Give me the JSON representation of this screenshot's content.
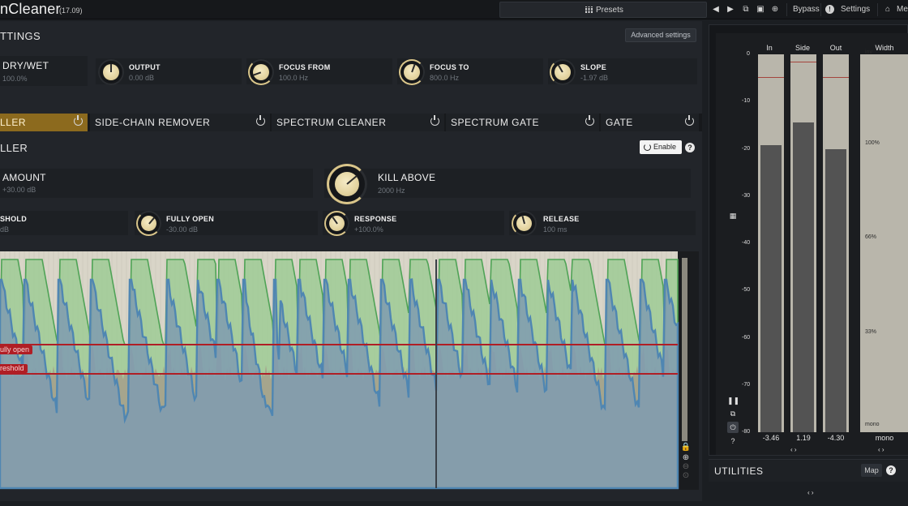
{
  "header": {
    "title": "nCleaner",
    "version": "(17.09)",
    "presets_label": "Presets",
    "bypass_label": "Bypass",
    "settings_label": "Settings",
    "menu_label": "Me"
  },
  "settings": {
    "title": "TTINGS",
    "advanced_label": "Advanced settings",
    "params": [
      {
        "name": "DRY/WET",
        "value": "100.0%"
      },
      {
        "name": "OUTPUT",
        "value": "0.00 dB"
      },
      {
        "name": "FOCUS FROM",
        "value": "100.0 Hz"
      },
      {
        "name": "FOCUS TO",
        "value": "800.0 Hz"
      },
      {
        "name": "SLOPE",
        "value": "-1.97 dB"
      }
    ]
  },
  "tabs": [
    {
      "label": "LLER",
      "active": true
    },
    {
      "label": "SIDE-CHAIN REMOVER",
      "active": false
    },
    {
      "label": "SPECTRUM CLEANER",
      "active": false
    },
    {
      "label": "SPECTRUM GATE",
      "active": false
    },
    {
      "label": "GATE",
      "active": false
    }
  ],
  "module": {
    "title": "LLER",
    "enable_label": "Enable",
    "help": "?",
    "amount": {
      "name": "AMOUNT",
      "value": "+30.00 dB"
    },
    "kill_above": {
      "name": "KILL ABOVE",
      "value": "2000 Hz"
    },
    "threshold": {
      "name": "SHOLD",
      "value": "dB"
    },
    "fully_open": {
      "name": "FULLY OPEN",
      "value": "-30.00 dB"
    },
    "response": {
      "name": "RESPONSE",
      "value": "+100.0%"
    },
    "release": {
      "name": "RELEASE",
      "value": "100 ms"
    }
  },
  "graph": {
    "fully_open_label": "ully open",
    "threshold_label": "reshold"
  },
  "meters": {
    "columns": [
      {
        "name": "In",
        "level": 0.76,
        "peak": 0.06,
        "value": "-3.46"
      },
      {
        "name": "Side",
        "level": 0.82,
        "peak": 0.02,
        "value": "1.19"
      },
      {
        "name": "Out",
        "level": 0.75,
        "peak": 0.06,
        "value": "-4.30"
      }
    ],
    "width_title": "Width",
    "scale": [
      "0",
      "-10",
      "-20",
      "-30",
      "-40",
      "-50",
      "-60",
      "-70",
      "-80"
    ],
    "width_scale": [
      "inv",
      "100%",
      "66%",
      "33%",
      "mono"
    ],
    "width_value": "mono",
    "arrows": "‹ ›"
  },
  "utilities": {
    "title": "UTILITIES",
    "map_label": "Map",
    "help": "?"
  },
  "colors": {
    "accent": "#8c6a1e",
    "knob": "#e3d39f",
    "graph_green": "#8fc38a",
    "graph_blue": "#4f86b2",
    "marker_red": "#b01e25"
  }
}
